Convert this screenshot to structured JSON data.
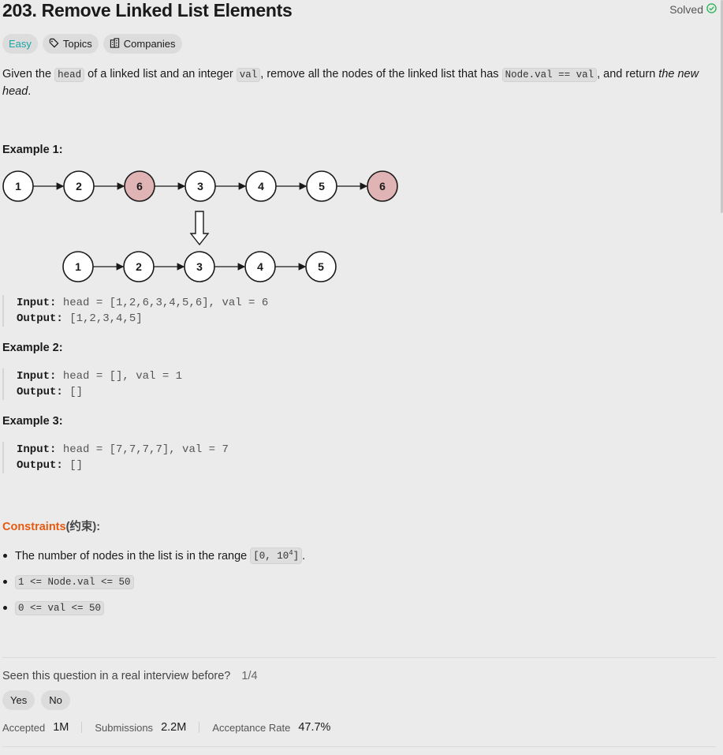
{
  "problem": {
    "title": "203. Remove Linked List Elements",
    "status": "Solved",
    "difficulty": "Easy",
    "topics_label": "Topics",
    "companies_label": "Companies"
  },
  "description": {
    "t1": "Given the ",
    "c1": "head",
    "t2": " of a linked list and an integer ",
    "c2": "val",
    "t3": ", remove all the nodes of the linked list that has ",
    "c3": "Node.val == val",
    "t4": ", and return ",
    "t5": "the new head",
    "t6": "."
  },
  "diagram": {
    "top_nodes": [
      "1",
      "2",
      "6",
      "3",
      "4",
      "5",
      "6"
    ],
    "top_removed": [
      false,
      false,
      true,
      false,
      false,
      false,
      true
    ],
    "bottom_nodes": [
      "1",
      "2",
      "3",
      "4",
      "5"
    ],
    "colors": {
      "node_fill": "#ffffff",
      "removed_fill": "#e0b4b4",
      "stroke": "#1a1a1a"
    }
  },
  "examples": [
    {
      "heading": "Example 1:",
      "input_label": "Input:",
      "input": " head = [1,2,6,3,4,5,6], val = 6",
      "output_label": "Output:",
      "output": " [1,2,3,4,5]"
    },
    {
      "heading": "Example 2:",
      "input_label": "Input:",
      "input": " head = [], val = 1",
      "output_label": "Output:",
      "output": " []"
    },
    {
      "heading": "Example 3:",
      "input_label": "Input:",
      "input": " head = [7,7,7,7], val = 7",
      "output_label": "Output:",
      "output": " []"
    }
  ],
  "constraints": {
    "heading_en": "Constraints",
    "heading_cn": "(约束):",
    "c1_text": "The number of nodes in the list is in the range ",
    "c1_code_a": "[0, 10",
    "c1_code_sup": "4",
    "c1_code_b": "]",
    "c1_end": ".",
    "c2_code": "1 <= Node.val <= 50",
    "c3_code": "0 <= val <= 50"
  },
  "feedback": {
    "question": "Seen this question in a real interview before?",
    "ratio": "1/4",
    "yes": "Yes",
    "no": "No"
  },
  "stats": {
    "accepted_label": "Accepted",
    "accepted": "1M",
    "submissions_label": "Submissions",
    "submissions": "2.2M",
    "rate_label": "Acceptance Rate",
    "rate": "47.7%"
  },
  "accent": {
    "solved_green": "#2db55d",
    "easy_teal": "#1ba5a5",
    "constraints_orange": "#e65a0f"
  }
}
